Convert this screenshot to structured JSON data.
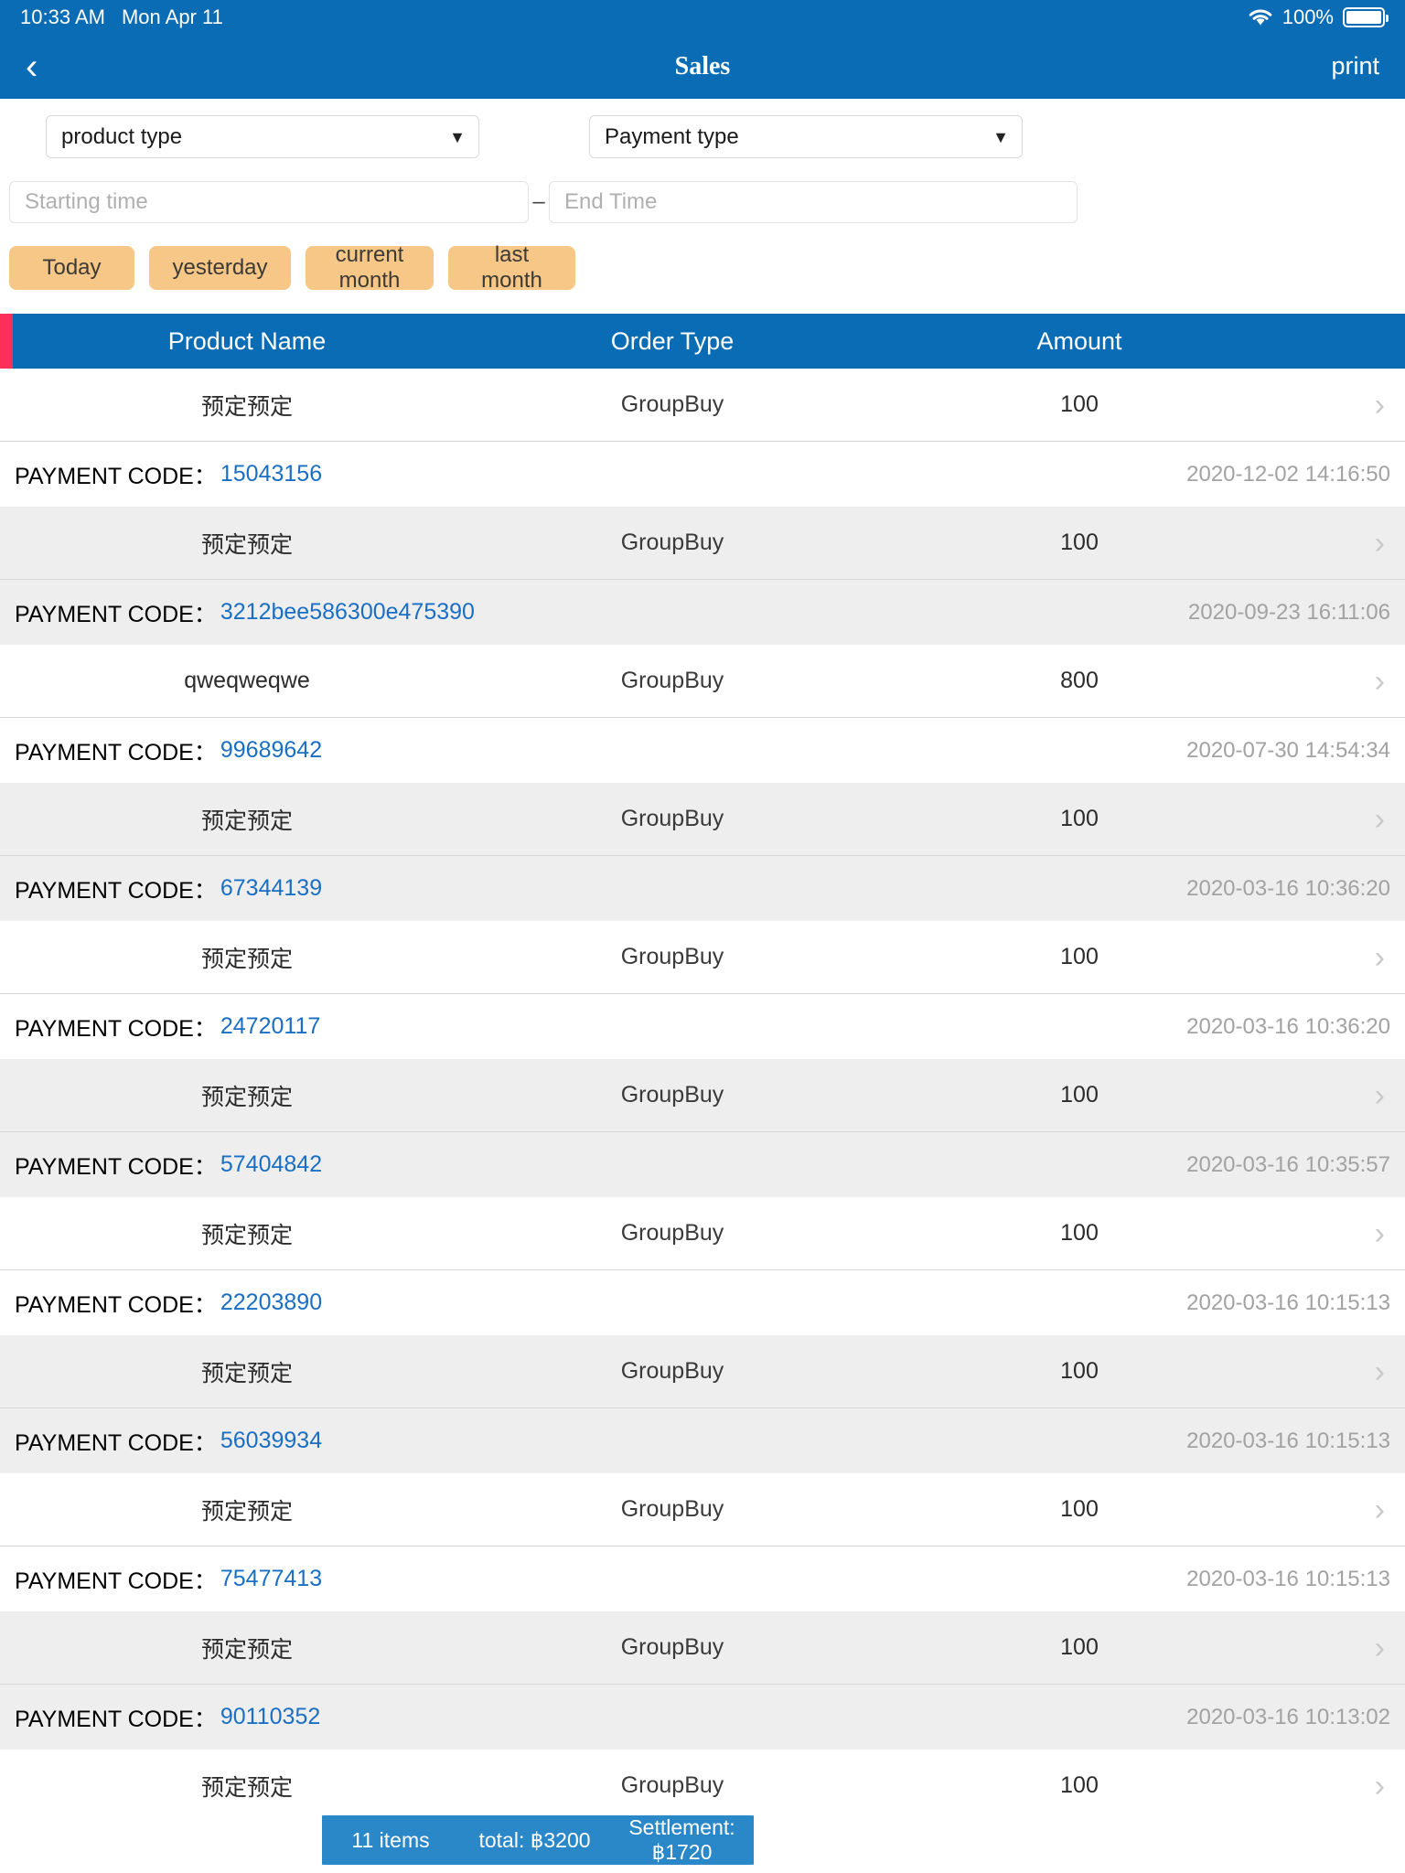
{
  "status_bar": {
    "time": "10:33 AM",
    "date": "Mon Apr 11",
    "battery_percent": "100%",
    "wifi_icon": "wifi-icon",
    "battery_icon": "battery-icon"
  },
  "nav": {
    "back_icon": "‹",
    "title": "Sales",
    "print_label": "print"
  },
  "filters": {
    "product_type_value": "product type",
    "payment_type_value": "Payment type",
    "caret_icon": "▼",
    "start_time_placeholder": "Starting time",
    "start_time_value": "",
    "end_time_placeholder": "End Time",
    "end_time_value": "",
    "date_separator": "–",
    "quick_buttons": [
      {
        "label": "Today"
      },
      {
        "label": "yesterday"
      },
      {
        "label": "current month"
      },
      {
        "label": "last month"
      }
    ]
  },
  "table": {
    "accent_color": "#fc2e5a",
    "header_color": "#0a6cb4",
    "columns": [
      "Product Name",
      "Order Type",
      "Amount"
    ],
    "payment_code_label": "PAYMENT CODE：",
    "chevron_icon": "›",
    "rows": [
      {
        "product": "预定预定",
        "order_type": "GroupBuy",
        "amount": "100",
        "payment_code": "15043156",
        "timestamp": "2020-12-02 14:16:50"
      },
      {
        "product": "预定预定",
        "order_type": "GroupBuy",
        "amount": "100",
        "payment_code": "3212bee586300e475390",
        "timestamp": "2020-09-23 16:11:06"
      },
      {
        "product": "qweqweqwe",
        "order_type": "GroupBuy",
        "amount": "800",
        "payment_code": "99689642",
        "timestamp": "2020-07-30 14:54:34"
      },
      {
        "product": "预定预定",
        "order_type": "GroupBuy",
        "amount": "100",
        "payment_code": "67344139",
        "timestamp": "2020-03-16 10:36:20"
      },
      {
        "product": "预定预定",
        "order_type": "GroupBuy",
        "amount": "100",
        "payment_code": "24720117",
        "timestamp": "2020-03-16 10:36:20"
      },
      {
        "product": "预定预定",
        "order_type": "GroupBuy",
        "amount": "100",
        "payment_code": "57404842",
        "timestamp": "2020-03-16 10:35:57"
      },
      {
        "product": "预定预定",
        "order_type": "GroupBuy",
        "amount": "100",
        "payment_code": "22203890",
        "timestamp": "2020-03-16 10:15:13"
      },
      {
        "product": "预定预定",
        "order_type": "GroupBuy",
        "amount": "100",
        "payment_code": "56039934",
        "timestamp": "2020-03-16 10:15:13"
      },
      {
        "product": "预定预定",
        "order_type": "GroupBuy",
        "amount": "100",
        "payment_code": "75477413",
        "timestamp": "2020-03-16 10:15:13"
      },
      {
        "product": "预定预定",
        "order_type": "GroupBuy",
        "amount": "100",
        "payment_code": "90110352",
        "timestamp": "2020-03-16 10:13:02"
      },
      {
        "product": "预定预定",
        "order_type": "GroupBuy",
        "amount": "100",
        "payment_code": "",
        "timestamp": ""
      }
    ]
  },
  "summary": {
    "items": "11 items",
    "total": "total: ฿3200",
    "settlement": "Settlement: ฿1720"
  }
}
